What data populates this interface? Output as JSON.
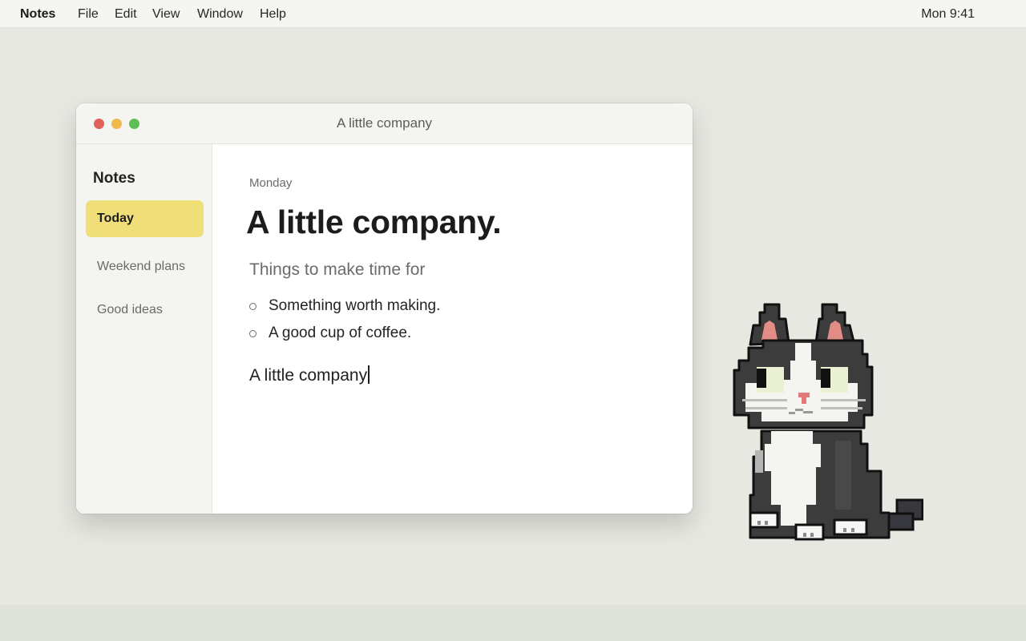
{
  "menubar": {
    "app_name": "Notes",
    "menus": [
      "File",
      "Edit",
      "View",
      "Window",
      "Help"
    ],
    "clock": "Mon 9:41"
  },
  "window": {
    "title": "A little company"
  },
  "sidebar": {
    "heading": "Notes",
    "items": [
      {
        "label": "Today",
        "active": true
      },
      {
        "label": "Weekend plans",
        "active": false
      },
      {
        "label": "Good ideas",
        "active": false
      }
    ]
  },
  "note": {
    "day": "Monday",
    "title": "A little company.",
    "subtitle": "Things to make time for",
    "checklist": [
      {
        "text": "Something worth making.",
        "checked": false
      },
      {
        "text": "A good cup of coffee.",
        "checked": false
      }
    ],
    "body": "A little company"
  },
  "colors": {
    "desktop": "#e6e8e1",
    "active_item": "#f0de78",
    "close": "#e0605a",
    "minimize": "#f0b94b",
    "maximize": "#5fbf57"
  },
  "decoration": {
    "icon": "pixel-cat-icon"
  }
}
